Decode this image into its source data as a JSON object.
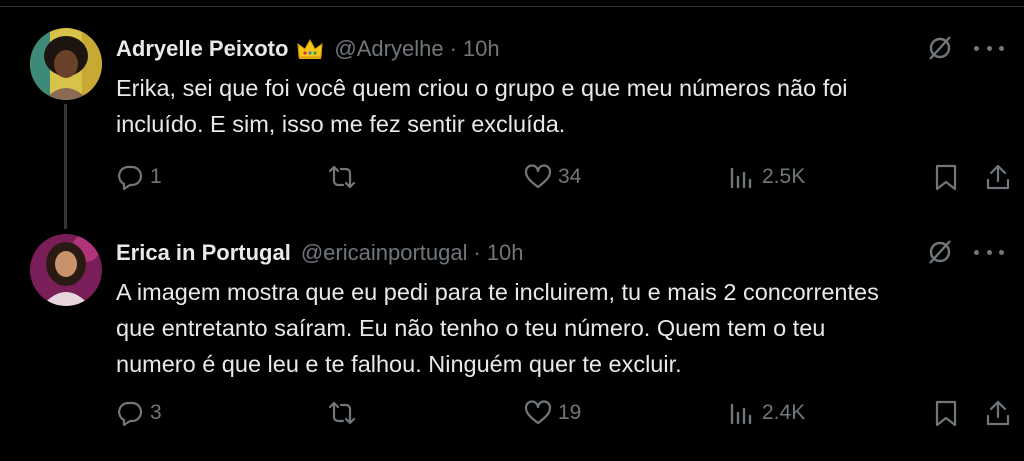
{
  "tweets": [
    {
      "name": "Adryelle Peixoto",
      "handle": "@Adryelhe",
      "separator": "·",
      "time": "10h",
      "badge_icon": "crown-icon",
      "text_lines": [
        "Erika, sei que foi você quem criou o grupo e que meu números não foi",
        "incluído. E sim, isso me fez sentir excluída."
      ],
      "replies": "1",
      "retweets": "",
      "likes": "34",
      "views": "2.5K"
    },
    {
      "name": "Erica in Portugal",
      "handle": "@ericainportugal",
      "separator": "·",
      "time": "10h",
      "text_lines": [
        "A imagem mostra que eu pedi para te incluirem, tu e mais 2 concorrentes",
        "que entretanto saíram. Eu não tenho o teu número. Quem tem o teu",
        "numero é que leu e te falhou. Ninguém quer te excluir."
      ],
      "replies": "3",
      "retweets": "",
      "likes": "19",
      "views": "2.4K"
    }
  ],
  "colors": {
    "background": "#000000",
    "text": "#e7e9ea",
    "muted": "#71767b",
    "divider": "#2f3336",
    "crown": "#f5c518"
  }
}
